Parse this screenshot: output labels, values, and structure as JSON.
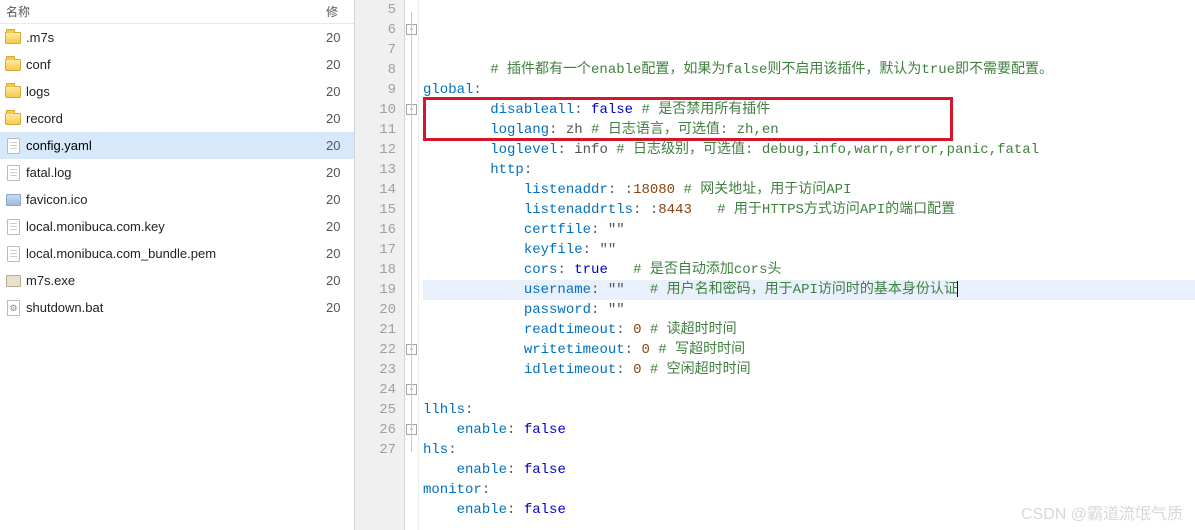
{
  "filePanel": {
    "header": {
      "name": "名称",
      "modified": "修"
    },
    "items": [
      {
        "name": ".m7s",
        "type": "folder",
        "mod": "20"
      },
      {
        "name": "conf",
        "type": "folder",
        "mod": "20"
      },
      {
        "name": "logs",
        "type": "folder",
        "mod": "20"
      },
      {
        "name": "record",
        "type": "folder",
        "mod": "20"
      },
      {
        "name": "config.yaml",
        "type": "file",
        "mod": "20",
        "selected": true
      },
      {
        "name": "fatal.log",
        "type": "file",
        "mod": "20"
      },
      {
        "name": "favicon.ico",
        "type": "ico",
        "mod": "20"
      },
      {
        "name": "local.monibuca.com.key",
        "type": "file",
        "mod": "20"
      },
      {
        "name": "local.monibuca.com_bundle.pem",
        "type": "file",
        "mod": "20"
      },
      {
        "name": "m7s.exe",
        "type": "exe",
        "mod": "20"
      },
      {
        "name": "shutdown.bat",
        "type": "bat",
        "mod": "20"
      }
    ]
  },
  "editor": {
    "startLine": 5,
    "highlightedLines": [
      10,
      11
    ],
    "currentLine": 16,
    "lines": [
      {
        "n": 5,
        "indent": 2,
        "comment": "# 插件都有一个enable配置，如果为false则不启用该插件，默认为true即不需要配置。"
      },
      {
        "n": 6,
        "indent": 0,
        "fold": true,
        "key": "global",
        "after": ":"
      },
      {
        "n": 7,
        "indent": 2,
        "key": "disableall",
        "after": ": ",
        "bool": "false",
        "comment": " # 是否禁用所有插件"
      },
      {
        "n": 8,
        "indent": 2,
        "key": "loglang",
        "after": ": zh ",
        "comment": "# 日志语言，可选值: zh,en"
      },
      {
        "n": 9,
        "indent": 2,
        "key": "loglevel",
        "after": ": info ",
        "comment": "# 日志级别，可选值: debug,info,warn,error,panic,fatal"
      },
      {
        "n": 10,
        "indent": 2,
        "fold": true,
        "key": "http",
        "after": ":"
      },
      {
        "n": 11,
        "indent": 3,
        "key": "listenaddr",
        "after": ": :",
        "num": "18080",
        "comment": " # 网关地址，用于访问API"
      },
      {
        "n": 12,
        "indent": 3,
        "key": "listenaddrtls",
        "after": ": :",
        "num": "8443",
        "comment": "   # 用于HTTPS方式访问API的端口配置"
      },
      {
        "n": 13,
        "indent": 3,
        "key": "certfile",
        "after": ": \"\""
      },
      {
        "n": 14,
        "indent": 3,
        "key": "keyfile",
        "after": ": \"\""
      },
      {
        "n": 15,
        "indent": 3,
        "key": "cors",
        "after": ": ",
        "bool": "true",
        "comment": "   # 是否自动添加cors头"
      },
      {
        "n": 16,
        "indent": 3,
        "key": "username",
        "after": ": \"\"   ",
        "comment": "# 用户名和密码，用于API访问时的基本身份认证",
        "current": true,
        "caretAt": 26
      },
      {
        "n": 17,
        "indent": 3,
        "key": "password",
        "after": ": \"\""
      },
      {
        "n": 18,
        "indent": 3,
        "key": "readtimeout",
        "after": ": ",
        "num": "0",
        "comment": " # 读超时时间"
      },
      {
        "n": 19,
        "indent": 3,
        "key": "writetimeout",
        "after": ": ",
        "num": "0",
        "comment": " # 写超时时间"
      },
      {
        "n": 20,
        "indent": 3,
        "key": "idletimeout",
        "after": ": ",
        "num": "0",
        "comment": " # 空闲超时时间"
      },
      {
        "n": 21,
        "indent": 0
      },
      {
        "n": 22,
        "indent": 0,
        "fold": true,
        "key": "llhls",
        "after": ":"
      },
      {
        "n": 23,
        "indent": 1,
        "key": "enable",
        "after": ": ",
        "bool": "false"
      },
      {
        "n": 24,
        "indent": 0,
        "fold": true,
        "key": "hls",
        "after": ":"
      },
      {
        "n": 25,
        "indent": 1,
        "key": "enable",
        "after": ": ",
        "bool": "false"
      },
      {
        "n": 26,
        "indent": 0,
        "fold": true,
        "key": "monitor",
        "after": ":"
      },
      {
        "n": 27,
        "indent": 1,
        "key": "enable",
        "after": ": ",
        "bool": "false"
      }
    ]
  },
  "watermark": "CSDN @霸道流氓气质"
}
